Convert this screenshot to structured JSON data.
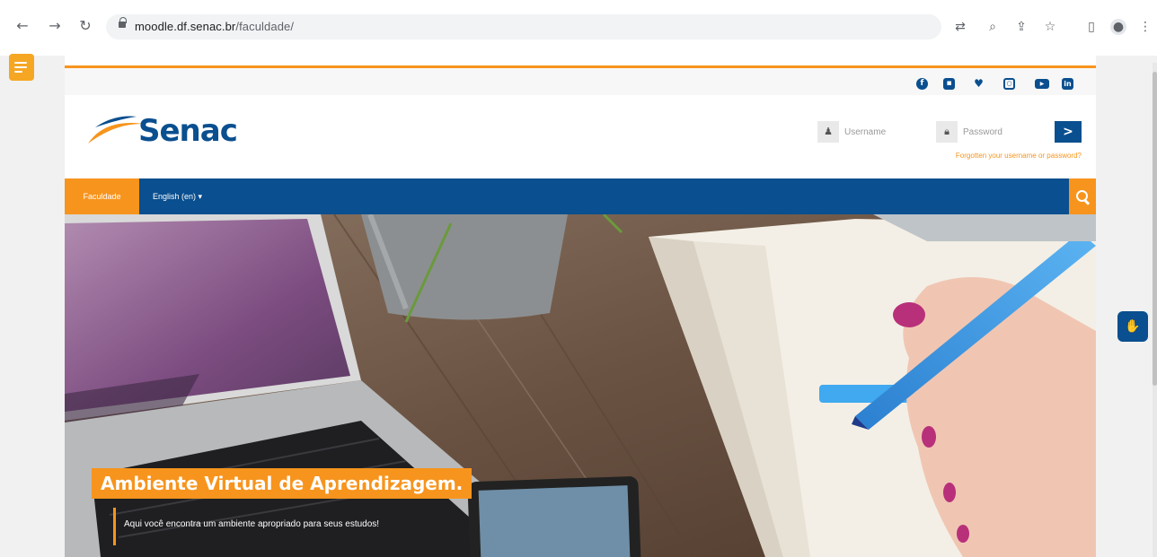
{
  "browser": {
    "url_domain": "moodle.df.senac.br",
    "url_path": "/faculdade/",
    "back_icon": "arrow-left-icon",
    "forward_icon": "arrow-right-icon",
    "reload_icon": "reload-icon",
    "toolbar_icons": [
      "translate-icon",
      "zoom-icon",
      "share-icon",
      "star-icon",
      "sidepanel-icon",
      "profile-icon",
      "menu-icon"
    ]
  },
  "brand": {
    "logo_text": "Senac",
    "primary_color": "#0a4f8f",
    "accent_color": "#f7941d"
  },
  "social": [
    "facebook-icon",
    "discord-icon",
    "twitter-icon",
    "instagram-icon",
    "youtube-icon",
    "linkedin-icon"
  ],
  "login": {
    "username_placeholder": "Username",
    "password_placeholder": "Password",
    "submit_label": ">",
    "forgot_link": "Forgotten your username or password?"
  },
  "nav": {
    "active_item": "Faculdade",
    "language": "English (en) ▾"
  },
  "hero": {
    "title": "Ambiente Virtual de Aprendizagem.",
    "subtitle": "Aqui você encontra um ambiente apropriado para seus estudos!"
  }
}
